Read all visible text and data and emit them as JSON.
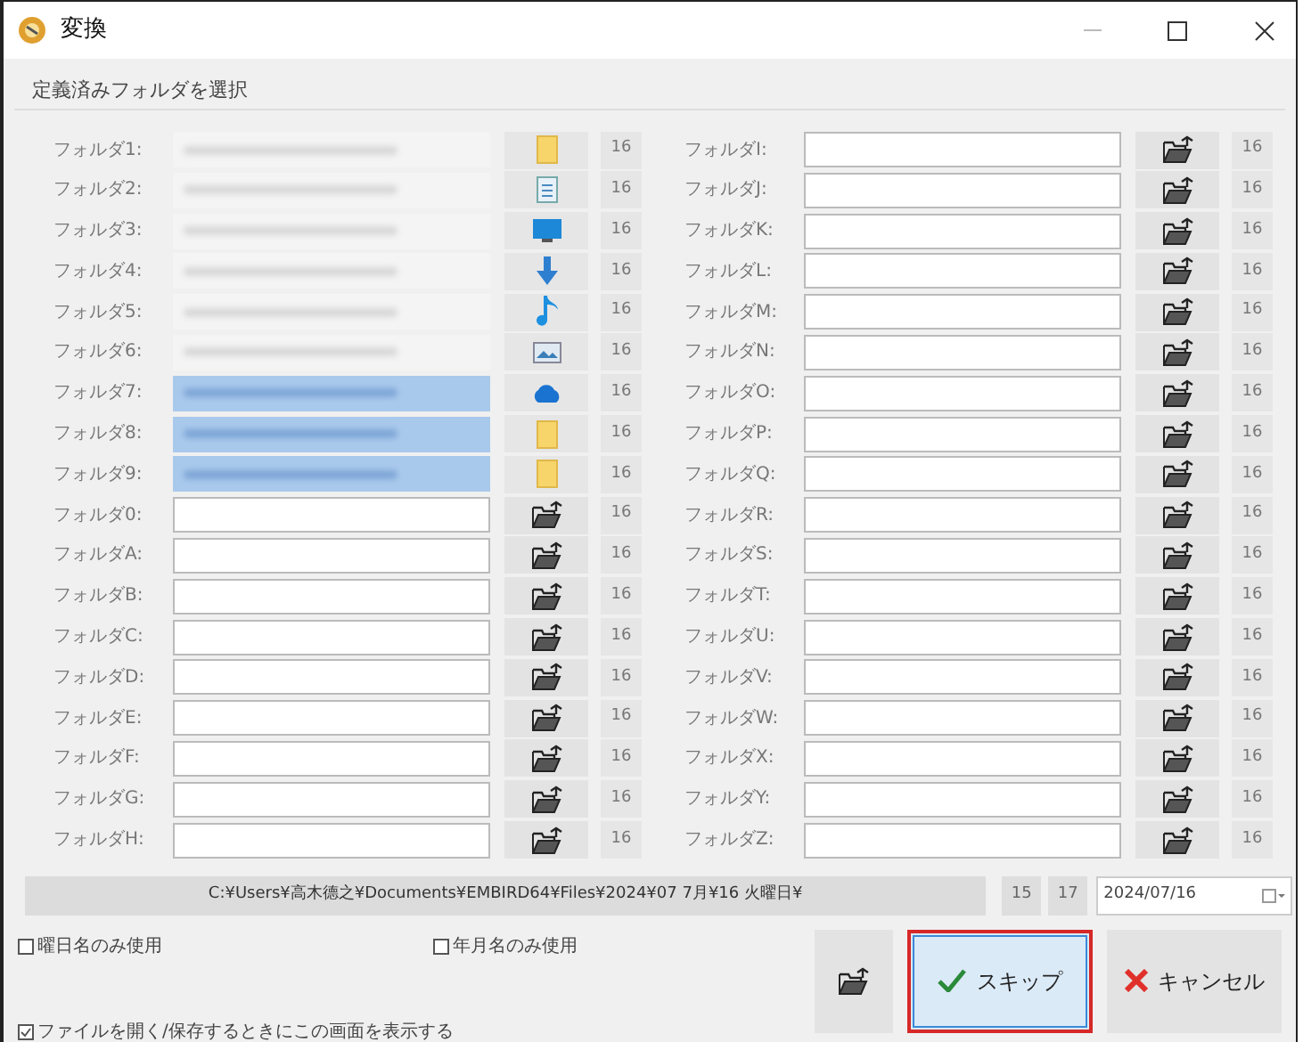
{
  "window": {
    "title": "変換"
  },
  "group": {
    "label": "定義済みフォルダを選択"
  },
  "columns": [
    [
      {
        "label": "フォルダ1:",
        "kind": "folder",
        "redacted": true,
        "highlighted": false,
        "size": "16"
      },
      {
        "label": "フォルダ2:",
        "kind": "document",
        "redacted": true,
        "highlighted": false,
        "size": "16"
      },
      {
        "label": "フォルダ3:",
        "kind": "monitor",
        "redacted": true,
        "highlighted": false,
        "size": "16"
      },
      {
        "label": "フォルダ4:",
        "kind": "download",
        "redacted": true,
        "highlighted": false,
        "size": "16"
      },
      {
        "label": "フォルダ5:",
        "kind": "music",
        "redacted": true,
        "highlighted": false,
        "size": "16"
      },
      {
        "label": "フォルダ6:",
        "kind": "picture",
        "redacted": true,
        "highlighted": false,
        "size": "16"
      },
      {
        "label": "フォルダ7:",
        "kind": "cloud",
        "redacted": true,
        "highlighted": true,
        "size": "16"
      },
      {
        "label": "フォルダ8:",
        "kind": "folder",
        "redacted": true,
        "highlighted": true,
        "size": "16"
      },
      {
        "label": "フォルダ9:",
        "kind": "folder",
        "redacted": true,
        "highlighted": true,
        "size": "16"
      },
      {
        "label": "フォルダ0:",
        "kind": "browse",
        "redacted": false,
        "highlighted": false,
        "size": "16"
      },
      {
        "label": "フォルダA:",
        "kind": "browse",
        "redacted": false,
        "highlighted": false,
        "size": "16"
      },
      {
        "label": "フォルダB:",
        "kind": "browse",
        "redacted": false,
        "highlighted": false,
        "size": "16"
      },
      {
        "label": "フォルダC:",
        "kind": "browse",
        "redacted": false,
        "highlighted": false,
        "size": "16"
      },
      {
        "label": "フォルダD:",
        "kind": "browse",
        "redacted": false,
        "highlighted": false,
        "size": "16"
      },
      {
        "label": "フォルダE:",
        "kind": "browse",
        "redacted": false,
        "highlighted": false,
        "size": "16"
      },
      {
        "label": "フォルダF:",
        "kind": "browse",
        "redacted": false,
        "highlighted": false,
        "size": "16"
      },
      {
        "label": "フォルダG:",
        "kind": "browse",
        "redacted": false,
        "highlighted": false,
        "size": "16"
      },
      {
        "label": "フォルダH:",
        "kind": "browse",
        "redacted": false,
        "highlighted": false,
        "size": "16"
      }
    ],
    [
      {
        "label": "フォルダI:",
        "kind": "browse",
        "redacted": false,
        "highlighted": false,
        "size": "16"
      },
      {
        "label": "フォルダJ:",
        "kind": "browse",
        "redacted": false,
        "highlighted": false,
        "size": "16"
      },
      {
        "label": "フォルダK:",
        "kind": "browse",
        "redacted": false,
        "highlighted": false,
        "size": "16"
      },
      {
        "label": "フォルダL:",
        "kind": "browse",
        "redacted": false,
        "highlighted": false,
        "size": "16"
      },
      {
        "label": "フォルダM:",
        "kind": "browse",
        "redacted": false,
        "highlighted": false,
        "size": "16"
      },
      {
        "label": "フォルダN:",
        "kind": "browse",
        "redacted": false,
        "highlighted": false,
        "size": "16"
      },
      {
        "label": "フォルダO:",
        "kind": "browse",
        "redacted": false,
        "highlighted": false,
        "size": "16"
      },
      {
        "label": "フォルダP:",
        "kind": "browse",
        "redacted": false,
        "highlighted": false,
        "size": "16"
      },
      {
        "label": "フォルダQ:",
        "kind": "browse",
        "redacted": false,
        "highlighted": false,
        "size": "16"
      },
      {
        "label": "フォルダR:",
        "kind": "browse",
        "redacted": false,
        "highlighted": false,
        "size": "16"
      },
      {
        "label": "フォルダS:",
        "kind": "browse",
        "redacted": false,
        "highlighted": false,
        "size": "16"
      },
      {
        "label": "フォルダT:",
        "kind": "browse",
        "redacted": false,
        "highlighted": false,
        "size": "16"
      },
      {
        "label": "フォルダU:",
        "kind": "browse",
        "redacted": false,
        "highlighted": false,
        "size": "16"
      },
      {
        "label": "フォルダV:",
        "kind": "browse",
        "redacted": false,
        "highlighted": false,
        "size": "16"
      },
      {
        "label": "フォルダW:",
        "kind": "browse",
        "redacted": false,
        "highlighted": false,
        "size": "16"
      },
      {
        "label": "フォルダX:",
        "kind": "browse",
        "redacted": false,
        "highlighted": false,
        "size": "16"
      },
      {
        "label": "フォルダY:",
        "kind": "browse",
        "redacted": false,
        "highlighted": false,
        "size": "16"
      },
      {
        "label": "フォルダZ:",
        "kind": "browse",
        "redacted": false,
        "highlighted": false,
        "size": "16"
      }
    ]
  ],
  "path_bar": {
    "text": "C:¥Users¥高木德之¥Documents¥EMBIRD64¥Files¥2024¥07 7月¥16 火曜日¥",
    "counts": [
      "15",
      "17"
    ],
    "date": "2024/07/16"
  },
  "checkboxes": [
    {
      "label": "曜日名のみ使用",
      "checked": false
    },
    {
      "label": "年月名のみ使用",
      "checked": false
    },
    {
      "label": "ファイルを開く/保存するときにこの画面を表示する",
      "checked": true
    }
  ],
  "buttons": [
    {
      "kind": "folder"
    },
    {
      "kind": "ok",
      "label": "スキップ",
      "focused": true
    },
    {
      "kind": "cancel",
      "label": "キャンセル",
      "focused": false
    }
  ]
}
